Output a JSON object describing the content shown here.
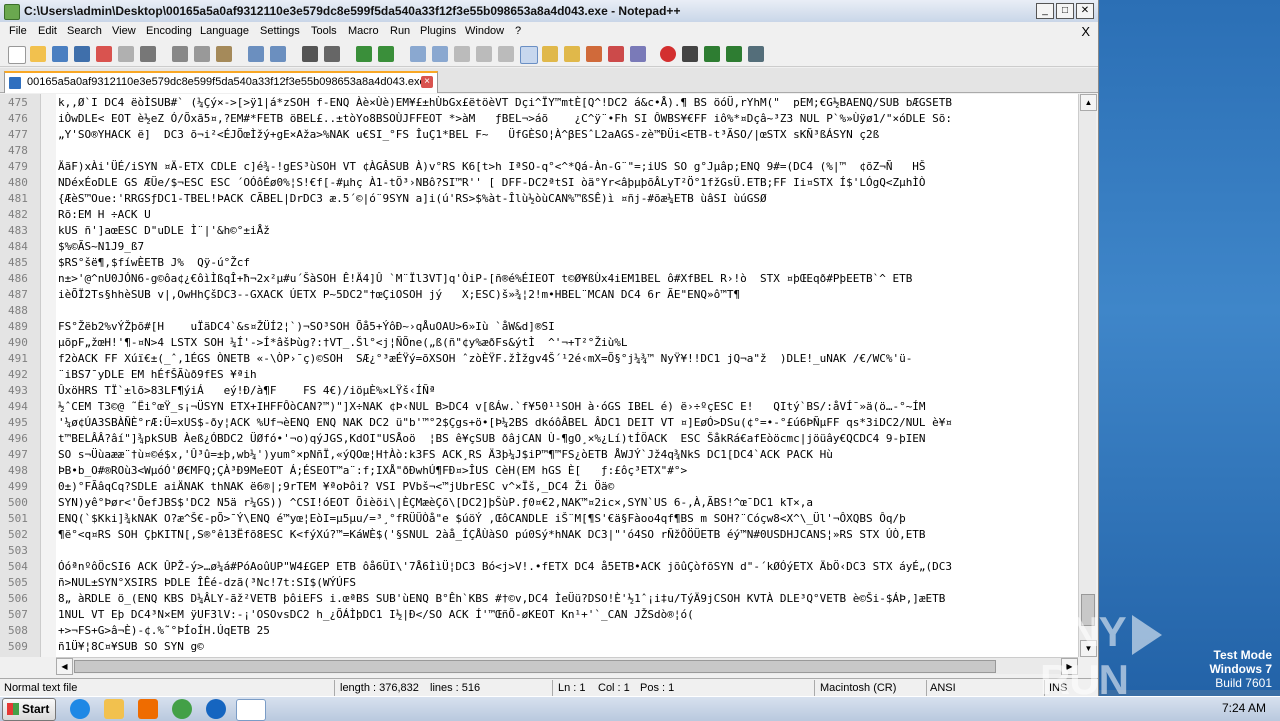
{
  "window": {
    "title": "C:\\Users\\admin\\Desktop\\00165a5a0af9312110e3e579dc8e599f5da540a33f12f3e55b098653a8a4d043.exe - Notepad++"
  },
  "menu": [
    "File",
    "Edit",
    "Search",
    "View",
    "Encoding",
    "Language",
    "Settings",
    "Tools",
    "Macro",
    "Run",
    "Plugins",
    "Window",
    "?"
  ],
  "menu_close": "X",
  "tab": {
    "label": "00165a5a0af9312110e3e579dc8e599f5da540a33f12f3e55b098653a8a4d043.exe",
    "close": "×"
  },
  "lines": [
    {
      "n": "475",
      "t": "k,,Ø`I DC4 ëòÌSUB#` (¼Çý×->[>ÿ1|á*zSOH f-ENQ Àè×Ùè)EM¥£±hÙbGx£ëtöèVT Dçi^ÏY™mtÈ[Q^!DC2 á&c•Å).¶ BS öóÜ,rYhM(\"  pEM;€G½BAENQ/SUB bÆGSETB"
    },
    {
      "n": "476",
      "t": "iÒwDLE< EOT è½eZ Ó/Õxã5¤,?EM#*FETB öBEL£..±tòYo8BSOÙJFFEOT *>àM   ƒBEL¬>áõ    ¿C^ÿ¨•Fh SI ÔWBS¥€FF iô%*¤Dçâ~³Z3 NUL P`%»Ùÿø1/\"×óDLE Sõ:"
    },
    {
      "n": "477",
      "t": "„Y'SO®YHACK ë]  DC3 õ¬i²<ÉJÕœÌžý+gE×Aža>%NAK u€SI_°FS ÎuÇ1*BEL F~   ÜfGÈSO¦À^βESˆL2aAGS-zè™ÐÜi<ETB-t³ÃSO/|œSTX sKÑ³ßÁSYN ç2ß"
    },
    {
      "n": "478",
      "t": ""
    },
    {
      "n": "479",
      "t": "ÄãF)xÀi'ÜÉ/iSYN ¤Ä-ETX CDLE c]é¾-!gES³ùSOH VT ¢ÀGÂSUB À)v°RS K6[t>h IªSO-q°<^*Qá-Àn-G¨\"=;iUS SO g°Jµâp;ENQ 9#=(DC4 (%|™  ¢õZ¬Ñ   HŠ"
    },
    {
      "n": "480",
      "t": "NDéxÉoDLE GS ÆÜe/$¬ESC ESC ´OÓôÉø0%¦S!€f[-#µhç À1-tÖ³›NBô?SI™R'' [ DFF-DC2ªtSI òä°Yr<âþµþõÂLyT²Ö°1fžGsÜ.ETB;FF Ii¤STX Í$'LÓgQ<ZµhÌÒ"
    },
    {
      "n": "481",
      "t": "{ÆèS™Oue:'RRGSƒDC1-TBEL!ÞACK CÃBEL|DrDC3 æ.5´©|ó¨9SYN a]i(ú'RS>$%àt-Îlù½òùCAN%™ßSÊ)ì ¤ñj-#õæ¼ETB ùâSI ùúGSØ"
    },
    {
      "n": "482",
      "t": "Rõ:EM H ÷ACK U"
    },
    {
      "n": "483",
      "t": "kUS ñ']aœESC D\"uDLE Ì¨|'&h©°±iÅž"
    },
    {
      "n": "484",
      "t": "$%©ÃS~N1J9_ß7"
    },
    {
      "n": "485",
      "t": "$RS°šë¶,$fíwÈETB J%  Qÿ-ú°Žcf"
    },
    {
      "n": "486",
      "t": "n±>'@^nU0JÓN6-g©ôa¢¿€ôìÌßqÎ+ħ¬2x²µ#u´ŠàSOH Ê!Ä4]Û `M¨Ïl3VT]q'ÒiP-[ñ®é%ÉIEOT t©Ø¥ßÙx4iEM1BEL ô#XfBEL R›!ò  STX ¤þŒEqð#PþEETB`^ ETB"
    },
    {
      "n": "487",
      "t": "ièÕÏ2Ts§hhèSUB v|,OwHhÇšDC3--GXACK ÚETX P~5DC2\"†œÇiOSOH jý   X;ESC)š»¾¦2!m•HBEL¨MCAN DC4 6r ÃE\"ENQ»ô™T¶"
    },
    {
      "n": "488",
      "t": ""
    },
    {
      "n": "489",
      "t": "FS°Žëb2%vÝŽþõ#[H    uÏäDC4`&s¤ŽÜÍ2¦`)¬SO³SOH Õå5+ÝôÐ~›qÅuOAU>6»Iù `åW&d]®SI"
    },
    {
      "n": "490",
      "t": "µõpF„žœH!'¶-¤N>4 LSTX SOH ¼Í'->Í*âšÞùg?:†VT_.Šl°<j¦ÑÕne(„ß(ñ\"¢y%æðFs&ýtÌ  ^'¬+T²°Žiù%L"
    },
    {
      "n": "491",
      "t": "f2òACK FF Xúï€±(_ˆ,1ÉGS ÒNETB «-\\ÒP›¯ç)©SOH  SÆ¿°³æÉŸý=õXSOH ˆzòÈŸF.žÌžgv4Š´¹2é‹mX=Õ§°j¼¾™ NyŸ¥!!DC1 jQ¬a\"ž  )DLE!_uNAK /€/WC%'ü-"
    },
    {
      "n": "492",
      "t": "¨iBS7¯yDLE EM hÉfŠÃùð9fES ¥ªih"
    },
    {
      "n": "493",
      "t": "ÛxöHRS TÏ`±lõ>83LF¶ýiÁ   eý!Ð/à¶F    FS 4€)/iöµÈ%×LŸš‹ÍÑª"
    },
    {
      "n": "494",
      "t": "½ˆCEM T3©@ ˜Ëi°œŸ_s¡¬ÜSYN ETX+IHFFÔòCAN?™)\"]X÷NAK ¢Þ‹NUL B>DC4 v[ßÁw.`f¥50¹¹SOH à·óGS IBEL é) ë›÷ºçESC E!   QItý`BS/:åVÍ¯»ä(ö…-°~ÍM"
    },
    {
      "n": "495",
      "t": "'¼ø¢ÚA3SBÀÑÈ°rÆ:Ü=xUS$-ðy¦ACK %Uf¬èENQ ENQ NAK DC2 ü\"b'™°2$Çgs+ö•[Þ¼2BS dkóôÂBEL ÂDC1 DEIT VT ¤]EøÓ>DSu(¢°=•-°£ú6ÞÑµFF qs*3iDC2/NUL è¥¤"
    },
    {
      "n": "496",
      "t": "t™BELÂÂ?âí\"]¾pkSUB Àeß¿ÓBDC2 ÜØfó•'¬o)qýJGS,KdOI\"USÅoö  ¦BS ê¥çSUB ðâjCAN Ù-¶gO¸×%¿Lí)tÍÖACK  ESC ŠåkRá€afEòöcmc|jöüây€QCDC4 9-þIEN"
    },
    {
      "n": "497",
      "t": "SO s¬Üùaææ¨†ù¤©é$x,'Û³û=±þ,wb¼')yum°×pNñÏ,«ýQOœ¦H†Àò:k3FS ACK¸RS Ä3þ¼J$iP™¶™FS¿òETB ÅWJÝ`Jž4q¾NkS DC1[DC4`ACK PACK Hù"
    },
    {
      "n": "498",
      "t": "ÞB•b_O#®ROù3<WµóÓ'Ø€MFQ;ÇÀ³Ð9MeEOT Á;ÉSEOT™a¨:f;IXÅ\"ðÐwhÚ¶FÐ¤>ÎUS CèH(EM hGS È[   ƒ:£ôç³ETX\"#°>"
    },
    {
      "n": "499",
      "t": "0±)°FÃâqCq?SDLE aiÄNAK thNAK ë6®|;9rTEM ¥ªoÞôi? VSI PVbš¬<™jUbrESC v^×Ïš,_DC4 Ži Öä©"
    },
    {
      "n": "500",
      "t": "SYN)yê°Þør<'ÕefJBS$'DC2 N5ä r¼GS)) ^CSI!óEOT Õièöi\\|ÈÇMæèÇõ\\[DC2]þŠùP.ƒ0¤€2,NAK™¤2ic×,SYN`US 6-,À,ÃBS!^œ¯DC1 kT×,a"
    },
    {
      "n": "501",
      "t": "ENQ(`$Kki]¾kNAK O?æ^Š€-pÕ>¯Ý\\ENQ é™yœ¦EòI=µ5µu/=³¸°fRÜÜÒå\"e $úöÝ ,ŒôCANDLE iŠ¨M[¶S'€ä§Fàoo4qf¶BS m SOH?¨Cóçw8<X^\\_Ül'¬ÔXQBS Ôq/þ"
    },
    {
      "n": "502",
      "t": "¶ë°<q¤RS SOH ÇþKITN[,S®°ê13Ëfõ8ESC K<fýXú?™=KáWÈ$('§SNUL 2àå_ÍÇÅÙàSO pú0Sý*hNAK DC3|\"'ó4SO rÑžÔÖÜETB éý™N#0USDHJCANS¦»RS STX ÚÒ,ETB"
    },
    {
      "n": "503",
      "t": ""
    },
    {
      "n": "504",
      "t": "ÓóªnºôÖcSI6 ACK ÛPŽ-ý>…ø¼á#PóAoûUP\"W4£GEP ETB ôå6ÜI\\'7Å6ÌìÜ¦DC3 Bó<j>V!.•fETX DC4 å5ETB•ACK jõûÇòfõSYN d\"-´kØÓýETX ÄbÖ‹DC3 STX áyÉ„(DC3"
    },
    {
      "n": "505",
      "t": "ñ>NUL±SYN°XSIRS ÞDLE ÎÊé-dzã(³Nc!7t:SI$(WÝÚFS"
    },
    {
      "n": "506",
      "t": "8„ àRDLE ö_(ENQ KBS D¼ÂLY-ãž²VETB þôiEFS i.œªBS SUB'ùENQ B°Êh`KBS #†©v,DC4 ÌeÜü?DSO!È'½1ˆ¡i‡u/TýÄ9jCSOH KVTÀ DLE³Q°VETB è©Ši-$ÁÞ,]æETB"
    },
    {
      "n": "507",
      "t": "1NUL VT Eþ DC4³N×EM ÿUF3lV:-¡'OSOvsDC2 h_¿ÕÁÌþDC1 I½|Ð</SO ACK Í'™ŒñÕ-øKEOT Kn¹+'`_CAN JŽSdò®¦ó("
    },
    {
      "n": "508",
      "t": "+>¬FS+G>â¬È)-¢.%˜°ÞÍoÍH.ÚqETB 25"
    },
    {
      "n": "509",
      "t": "ñ1Ü¥¦8C¤¥SUB SO SYN g©"
    }
  ],
  "status": {
    "file_type": "Normal text file",
    "length": "length : 376,832",
    "lines": "lines : 516",
    "ln": "Ln : 1",
    "col": "Col : 1",
    "pos": "Pos : 1",
    "eol": "Macintosh (CR)",
    "encoding": "ANSI",
    "ins": "INS"
  },
  "taskbar": {
    "start": "Start",
    "time": "7:24 AM"
  },
  "watermark": {
    "left": "ANY",
    "right": "RUN"
  },
  "os_mode": {
    "line1": "Test Mode",
    "line2": "Windows 7",
    "line3": "Build 7601"
  }
}
